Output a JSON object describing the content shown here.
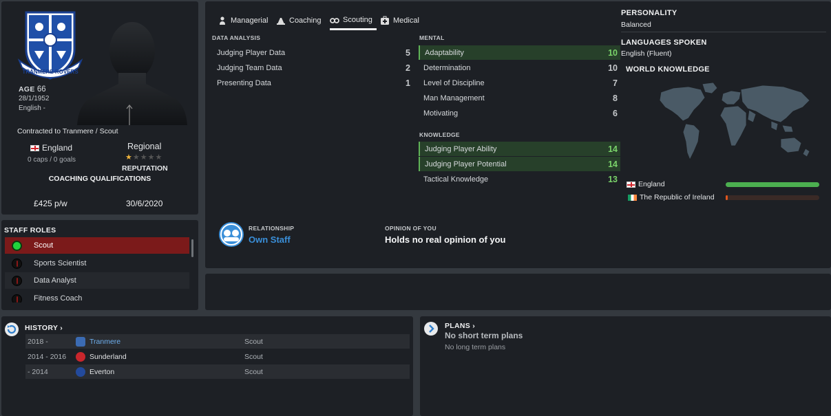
{
  "profile": {
    "age_label": "AGE",
    "age": "66",
    "dob": "28/1/1952",
    "nationality": "English -",
    "contract": "Contracted to Tranmere / Scout",
    "nation_name": "England",
    "caps_goals": "0 caps / 0 goals",
    "reputation_level": "Regional",
    "reputation_label": "REPUTATION",
    "reputation_stars": 1,
    "coaching_qualifications_label": "COACHING QUALIFICATIONS",
    "wage": "£425 p/w",
    "contract_expiry": "30/6/2020"
  },
  "staff_roles": {
    "title": "STAFF ROLES",
    "items": [
      {
        "label": "Scout",
        "active": true
      },
      {
        "label": "Sports Scientist",
        "active": false
      },
      {
        "label": "Data Analyst",
        "active": false
      },
      {
        "label": "Fitness Coach",
        "active": false
      }
    ]
  },
  "tabs": [
    {
      "label": "Managerial",
      "icon": "managerial-icon"
    },
    {
      "label": "Coaching",
      "icon": "coaching-icon"
    },
    {
      "label": "Scouting",
      "icon": "binoculars-icon",
      "active": true
    },
    {
      "label": "Medical",
      "icon": "medical-kit-icon"
    }
  ],
  "data_analysis": {
    "title": "DATA ANALYSIS",
    "rows": [
      {
        "name": "Judging Player Data",
        "value": "5"
      },
      {
        "name": "Judging Team Data",
        "value": "2"
      },
      {
        "name": "Presenting Data",
        "value": "1"
      }
    ]
  },
  "mental": {
    "title": "MENTAL",
    "rows": [
      {
        "name": "Adaptability",
        "value": "10",
        "highlight": true
      },
      {
        "name": "Determination",
        "value": "10"
      },
      {
        "name": "Level of Discipline",
        "value": "7"
      },
      {
        "name": "Man Management",
        "value": "8"
      },
      {
        "name": "Motivating",
        "value": "6"
      }
    ]
  },
  "knowledge": {
    "title": "KNOWLEDGE",
    "rows": [
      {
        "name": "Judging Player Ability",
        "value": "14",
        "highlight": true
      },
      {
        "name": "Judging Player Potential",
        "value": "14",
        "highlight": true
      },
      {
        "name": "Tactical Knowledge",
        "value": "13"
      }
    ]
  },
  "relationship": {
    "label": "RELATIONSHIP",
    "value": "Own Staff",
    "opinion_label": "OPINION OF YOU",
    "opinion_value": "Holds no real opinion of you"
  },
  "right_panel": {
    "personality_label": "PERSONALITY",
    "personality": "Balanced",
    "languages_label": "LANGUAGES SPOKEN",
    "languages": "English (Fluent)",
    "world_knowledge_label": "WORLD KNOWLEDGE",
    "knowledge_bars": [
      {
        "country": "England",
        "flag": "flag-england",
        "level": 1.0,
        "color": "#4caf50"
      },
      {
        "country": "The Republic of Ireland",
        "flag": "flag-ireland",
        "level": 0.02,
        "color": "#e0561e"
      }
    ]
  },
  "history": {
    "title": "HISTORY",
    "rows": [
      {
        "years": "2018 -",
        "club": "Tranmere",
        "role": "Scout",
        "link": true,
        "badge_color": "#3b6bb3"
      },
      {
        "years": "2014 - 2016",
        "club": "Sunderland",
        "role": "Scout",
        "link": false,
        "badge_color": "#c8262c"
      },
      {
        "years": "- 2014",
        "club": "Everton",
        "role": "Scout",
        "link": false,
        "badge_color": "#234a9c"
      }
    ]
  },
  "plans": {
    "title": "PLANS",
    "short_term": "No short term plans",
    "long_term": "No long term plans"
  },
  "colors": {
    "accent_blue": "#3a8fd9",
    "positive_green": "#4caf50",
    "active_role_red": "#7b1a1a"
  }
}
